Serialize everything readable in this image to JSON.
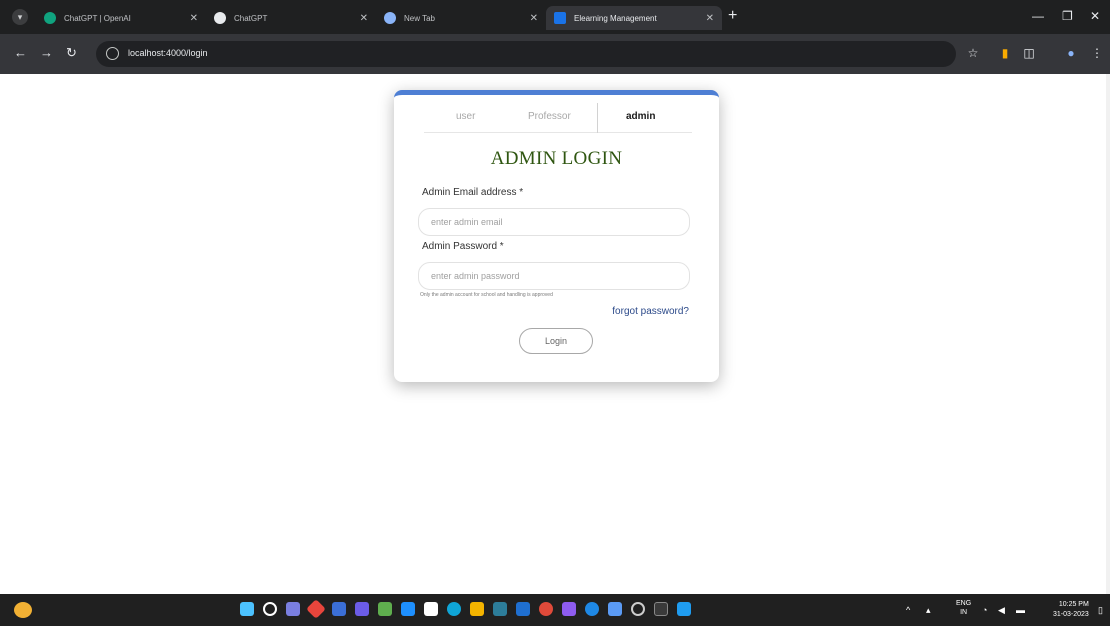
{
  "browser": {
    "tabs": [
      {
        "title": "ChatGPT | OpenAI",
        "active": false
      },
      {
        "title": "ChatGPT",
        "active": false
      },
      {
        "title": "New Tab",
        "active": false
      },
      {
        "title": "Elearning Management",
        "active": true
      }
    ],
    "new_tab_label": "+",
    "url": "localhost:4000/login"
  },
  "login": {
    "role_tabs": [
      "user",
      "Professor",
      "admin"
    ],
    "active_role": "admin",
    "title": "ADMIN LOGIN",
    "email_label": "Admin Email address *",
    "email_placeholder": "enter admin email",
    "password_label": "Admin Password *",
    "password_placeholder": "enter admin password",
    "hint": "Only the admin account for school and handling is approved",
    "forgot_label": "forgot password?",
    "login_button": "Login"
  },
  "taskbar": {
    "language": [
      "ENG",
      "IN"
    ],
    "time": "10:25 PM",
    "date": "31-03-2023"
  },
  "colors": {
    "accent_top_border": "#4e7fd4",
    "title_green": "#2f5611",
    "forgot_link": "#2c4a8a"
  }
}
